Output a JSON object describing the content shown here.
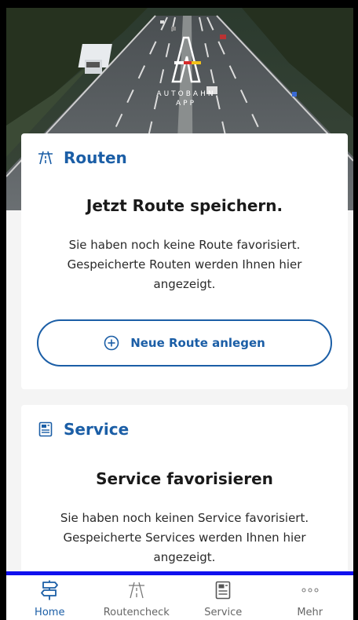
{
  "hero": {
    "logo_line1": "AUTOBAHN",
    "logo_line2": "APP"
  },
  "routen": {
    "header_icon": "highway-icon",
    "header": "Routen",
    "title": "Jetzt Route speichern.",
    "text": "Sie haben noch keine Route favorisiert. Gespeicherte Routen werden Ihnen hier angezeigt.",
    "button_icon": "plus-circle-icon",
    "button_label": "Neue Route anlegen"
  },
  "service": {
    "header_icon": "document-icon",
    "header": "Service",
    "title": "Service favorisieren",
    "text": "Sie haben noch keinen Service favorisiert. Gespeicherte Services werden Ihnen hier angezeigt."
  },
  "nav": {
    "items": [
      {
        "label": "Home",
        "icon": "signpost-icon",
        "active": true
      },
      {
        "label": "Routencheck",
        "icon": "highway-icon",
        "active": false
      },
      {
        "label": "Service",
        "icon": "document-icon",
        "active": false
      },
      {
        "label": "Mehr",
        "icon": "more-dots-icon",
        "active": false
      }
    ]
  },
  "colors": {
    "brand_blue": "#1b5ea6",
    "nav_highlight": "#1010ee"
  }
}
